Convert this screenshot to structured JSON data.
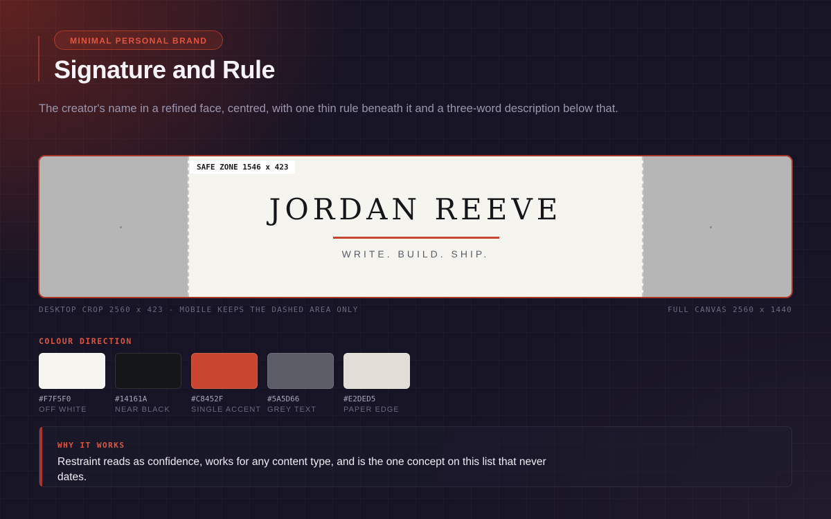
{
  "header": {
    "tag": "MINIMAL PERSONAL BRAND",
    "title": "Signature and Rule",
    "subtitle": "The creator's name in a refined face, centred, with one thin rule beneath it and a three-word description below that."
  },
  "banner": {
    "safe_zone_label": "SAFE ZONE 1546 x 423",
    "name": "JORDAN REEVE",
    "tagline": "WRITE. BUILD. SHIP.",
    "caption_left": "DESKTOP CROP 2560 x 423 - MOBILE KEEPS THE DASHED AREA ONLY",
    "caption_right": "FULL CANVAS 2560 x 1440"
  },
  "colours": {
    "label": "COLOUR DIRECTION",
    "swatches": [
      {
        "hex": "#F7F5F0",
        "name": "OFF WHITE",
        "color": "#F7F5F0"
      },
      {
        "hex": "#14161A",
        "name": "NEAR BLACK",
        "color": "#14161A"
      },
      {
        "hex": "#C8452F",
        "name": "SINGLE ACCENT",
        "color": "#C8452F"
      },
      {
        "hex": "#5A5D66",
        "name": "GREY TEXT",
        "color": "#5A5D66"
      },
      {
        "hex": "#E2DED5",
        "name": "PAPER EDGE",
        "color": "#E2DED5"
      }
    ]
  },
  "why": {
    "label": "WHY IT WORKS",
    "text": "Restraint reads as confidence, works for any content type, and is the one concept on this list that never dates."
  }
}
